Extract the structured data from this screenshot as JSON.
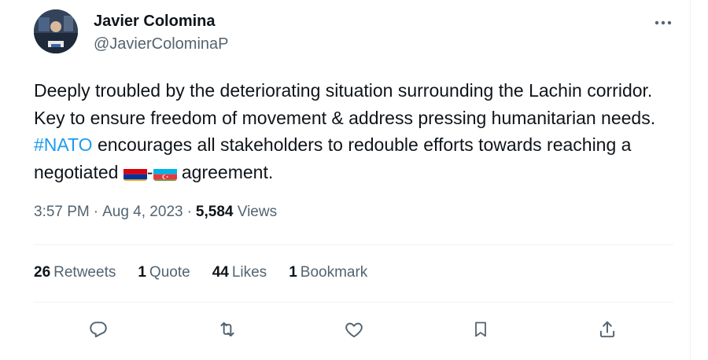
{
  "author": {
    "name": "Javier Colomina",
    "handle": "@JavierColominaP",
    "avatar_icon": "profile-photo"
  },
  "tweet": {
    "text_part1": "Deeply troubled by the deteriorating situation surrounding the Lachin corridor. Key to ensure freedom of movement & address pressing humanitarian needs. ",
    "hashtag": "#NATO",
    "text_part2": " encourages all stakeholders to redouble efforts towards reaching a negotiated ",
    "flag_separator": "-",
    "text_part3": " agreement.",
    "flags": [
      "armenia-flag",
      "azerbaijan-flag"
    ]
  },
  "meta": {
    "time": "3:57 PM",
    "separator": "·",
    "date": "Aug 4, 2023",
    "views_count": "5,584",
    "views_label": "Views"
  },
  "stats": [
    {
      "count": "26",
      "label": "Retweets"
    },
    {
      "count": "1",
      "label": "Quote"
    },
    {
      "count": "44",
      "label": "Likes"
    },
    {
      "count": "1",
      "label": "Bookmark"
    }
  ],
  "actions": [
    "reply-icon",
    "retweet-icon",
    "like-icon",
    "bookmark-icon",
    "share-icon"
  ],
  "colors": {
    "text": "#0f1419",
    "secondary": "#536471",
    "link": "#1d9bf0",
    "divider": "#eff3f4"
  }
}
